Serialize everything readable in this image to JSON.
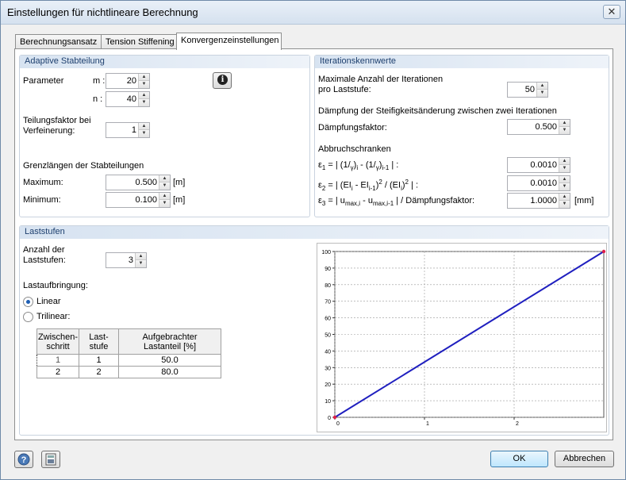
{
  "window": {
    "title": "Einstellungen für nichtlineare Berechnung",
    "close_glyph": "✕"
  },
  "tabs": [
    "Berechnungsansatz",
    "Tension Stiffening",
    "Konvergenzeinstellungen"
  ],
  "adaptive": {
    "title": "Adaptive Stabteilung",
    "parameter_label": "Parameter",
    "m_label": "m :",
    "m_value": "20",
    "n_label": "n :",
    "n_value": "40",
    "info_glyph": "i",
    "factor_label_1": "Teilungsfaktor bei",
    "factor_label_2": "Verfeinerung:",
    "factor_value": "1",
    "limits_title": "Grenzlängen der Stabteilungen",
    "max_label": "Maximum:",
    "max_value": "0.500",
    "min_label": "Minimum:",
    "min_value": "0.100",
    "unit": "[m]"
  },
  "iteration": {
    "title": "Iterationskennwerte",
    "max_iter_label_1": "Maximale Anzahl der Iterationen",
    "max_iter_label_2": "pro Laststufe:",
    "max_iter_value": "50",
    "damping_title": "Dämpfung der Steifigkeitsänderung zwischen zwei Iterationen",
    "damping_label": "Dämpfungsfaktor:",
    "damping_value": "0.500",
    "criteria_title": "Abbruchschranken",
    "eps1_value": "0.0010",
    "eps2_value": "0.0010",
    "eps3_value": "1.0000",
    "eps3_unit": "[mm]"
  },
  "load": {
    "title": "Laststufen",
    "count_label_1": "Anzahl der",
    "count_label_2": "Laststufen:",
    "count_value": "3",
    "application_label": "Lastaufbringung:",
    "linear_label": "Linear",
    "trilinear_label": "Trilinear:",
    "table_headers": [
      "Zwischen-\nschritt",
      "Last-\nstufe",
      "Aufgebrachter\nLastanteil [%]"
    ],
    "table_rows": [
      [
        "1",
        "1",
        "50.0"
      ],
      [
        "2",
        "2",
        "80.0"
      ]
    ]
  },
  "chart_data": {
    "type": "line",
    "x": [
      0,
      3
    ],
    "y": [
      0,
      100
    ],
    "xticks": [
      "0",
      "1",
      "2"
    ],
    "yticks": [
      "0",
      "10",
      "20",
      "30",
      "40",
      "50",
      "60",
      "70",
      "80",
      "90",
      "100"
    ],
    "xlim": [
      0,
      3
    ],
    "ylim": [
      0,
      100
    ],
    "grid": true,
    "line_color": "#1f1fbf",
    "endpoint_color": "#e0204a"
  },
  "footer": {
    "ok": "OK",
    "cancel": "Abbrechen",
    "help_icon": "help-icon",
    "save_icon": "save-settings-icon"
  }
}
